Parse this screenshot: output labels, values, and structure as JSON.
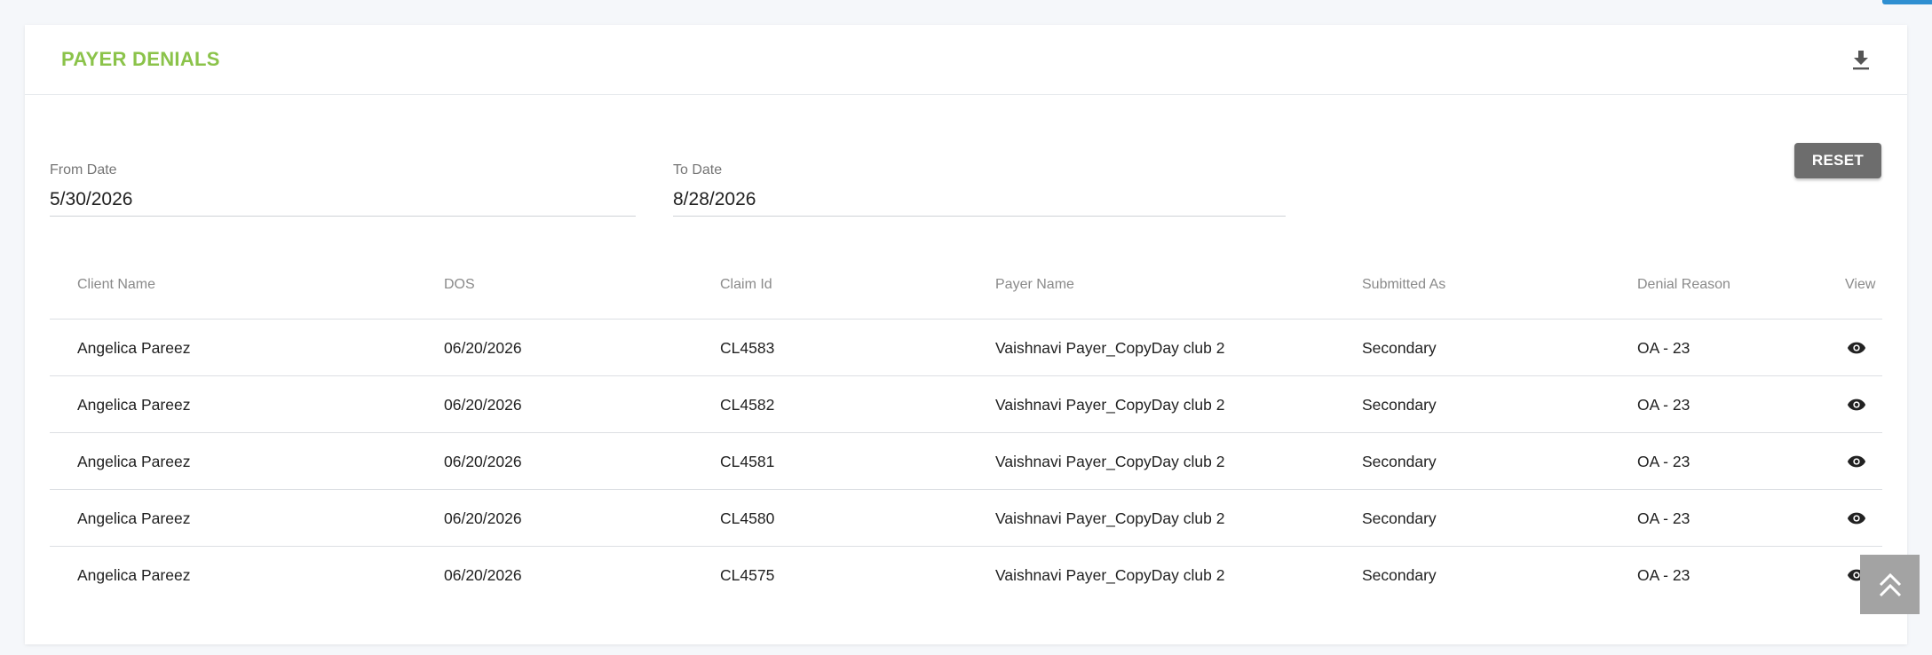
{
  "card": {
    "title": "PAYER DENIALS",
    "download_icon": "download-icon"
  },
  "filters": {
    "from_label": "From Date",
    "from_value": "5/30/2026",
    "to_label": "To Date",
    "to_value": "8/28/2026",
    "reset_label": "RESET"
  },
  "table": {
    "headers": [
      "Client Name",
      "DOS",
      "Claim Id",
      "Payer Name",
      "Submitted As",
      "Denial Reason",
      "View"
    ],
    "rows": [
      {
        "client": "Angelica Pareez",
        "dos": "06/20/2026",
        "claim": "CL4583",
        "payer": "Vaishnavi Payer_CopyDay club 2",
        "submitted": "Secondary",
        "reason": "OA - 23",
        "view_icon": "eye-icon"
      },
      {
        "client": "Angelica Pareez",
        "dos": "06/20/2026",
        "claim": "CL4582",
        "payer": "Vaishnavi Payer_CopyDay club 2",
        "submitted": "Secondary",
        "reason": "OA - 23",
        "view_icon": "eye-icon"
      },
      {
        "client": "Angelica Pareez",
        "dos": "06/20/2026",
        "claim": "CL4581",
        "payer": "Vaishnavi Payer_CopyDay club 2",
        "submitted": "Secondary",
        "reason": "OA - 23",
        "view_icon": "eye-icon"
      },
      {
        "client": "Angelica Pareez",
        "dos": "06/20/2026",
        "claim": "CL4580",
        "payer": "Vaishnavi Payer_CopyDay club 2",
        "submitted": "Secondary",
        "reason": "OA - 23",
        "view_icon": "eye-icon"
      },
      {
        "client": "Angelica Pareez",
        "dos": "06/20/2026",
        "claim": "CL4575",
        "payer": "Vaishnavi Payer_CopyDay club 2",
        "submitted": "Secondary",
        "reason": "OA - 23",
        "view_icon": "eye-icon"
      }
    ]
  },
  "scroll_top_icon": "double-chevron-up-icon",
  "colors": {
    "title_green": "#8bc34a",
    "reset_gray": "#6d6d6d",
    "accent_blue": "#2f8fd1"
  }
}
